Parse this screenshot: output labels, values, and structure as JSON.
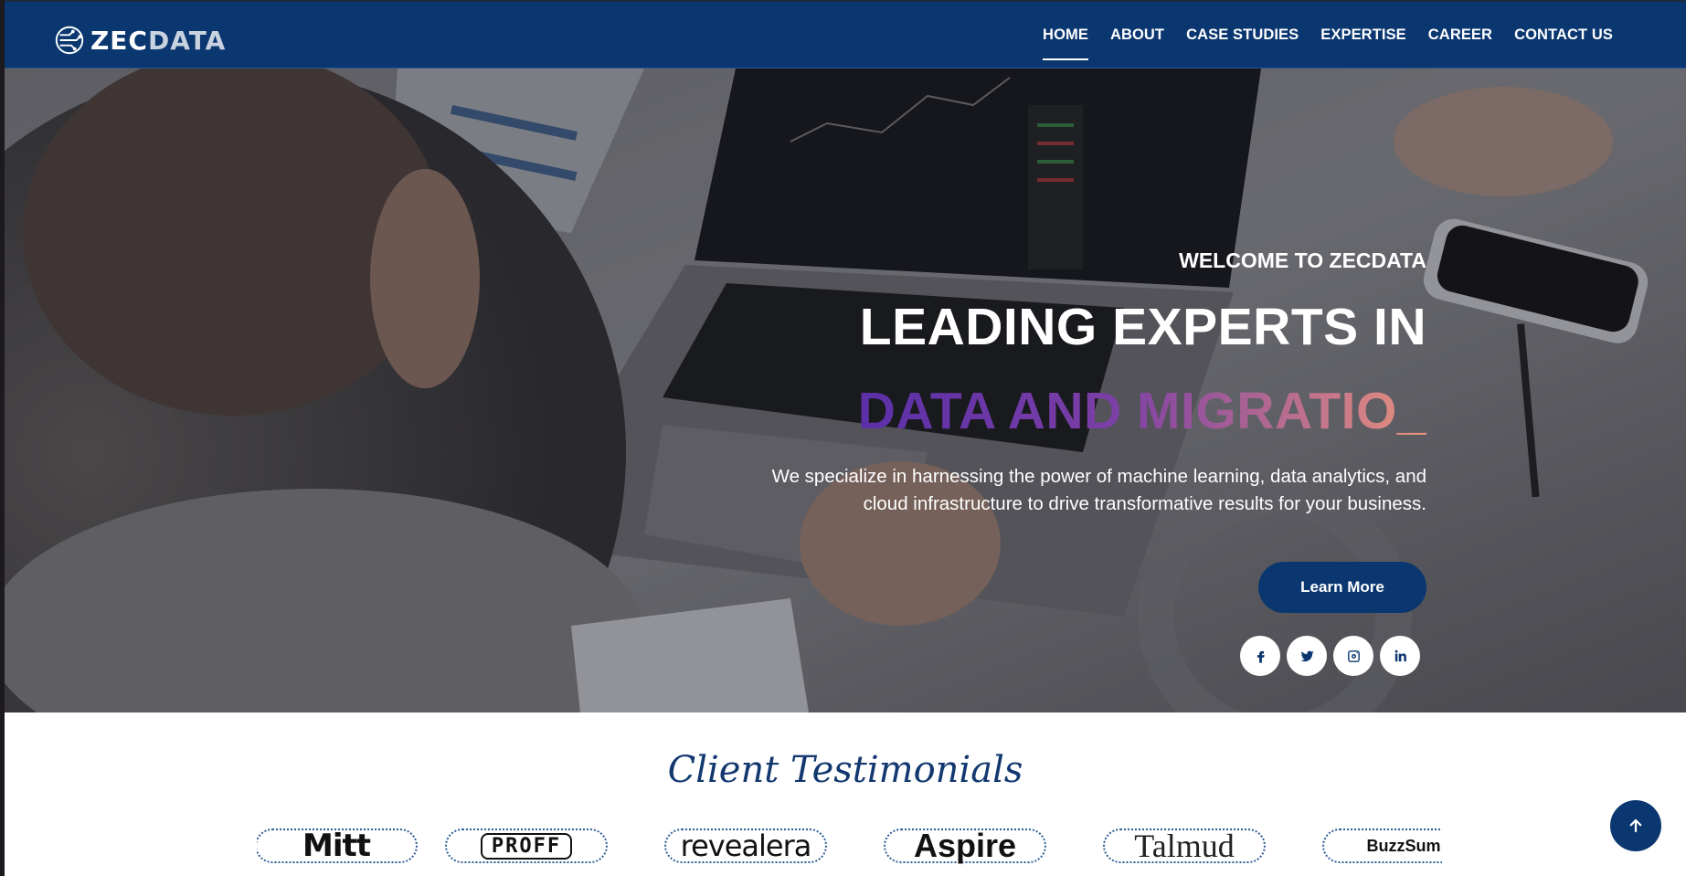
{
  "brand": {
    "logo_zec": "ZEC",
    "logo_data": "DATA"
  },
  "nav": {
    "items": [
      {
        "label": "HOME",
        "active": true
      },
      {
        "label": "ABOUT"
      },
      {
        "label": "CASE STUDIES"
      },
      {
        "label": "EXPERTISE"
      },
      {
        "label": "CAREER"
      },
      {
        "label": "CONTACT US"
      }
    ]
  },
  "hero": {
    "welcome": "WELCOME TO ZECDATA",
    "headline": "LEADING EXPERTS IN",
    "typed_text": "DATA AND MIGRATIO_",
    "description": "We specialize in harnessing the power of machine learning, data analytics, and cloud infrastructure to drive transformative results for your business.",
    "cta_label": "Learn More",
    "socials": [
      "facebook-icon",
      "twitter-icon",
      "instagram-icon",
      "linkedin-icon"
    ]
  },
  "testimonials": {
    "title": "Client Testimonials",
    "clients": [
      "Mitt",
      "PROFF",
      "revealera",
      "Aspire",
      "Talmud",
      "BuzzSum"
    ]
  },
  "colors": {
    "primary": "#0b3770",
    "gradient_start": "#5b2fa8",
    "gradient_end": "#e8917d"
  }
}
